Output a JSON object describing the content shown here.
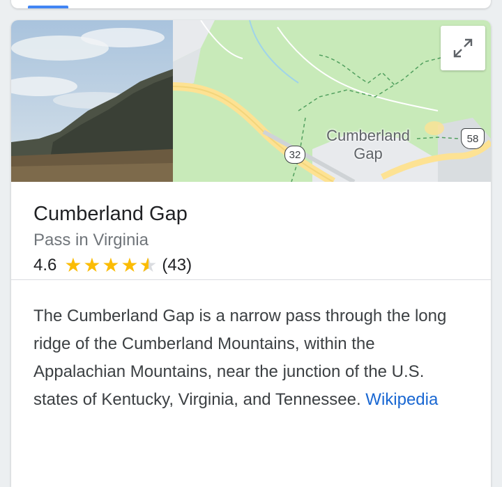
{
  "place": {
    "title": "Cumberland Gap",
    "subtitle": "Pass in Virginia",
    "rating": "4.6",
    "stars": 4.6,
    "review_count": "(43)"
  },
  "map": {
    "place_label_line1": "Cumberland",
    "place_label_line2": "Gap",
    "route_32": "32",
    "route_58": "58",
    "expand_icon": "expand-icon"
  },
  "description": {
    "text": "The Cumberland Gap is a narrow pass through the long ridge of the Cumberland Mountains, within the Appalachian Mountains, near the junction of the U.S. states of Kentucky, Virginia, and Tennessee. ",
    "source_link": "Wikipedia"
  },
  "colors": {
    "star": "#fbbc04",
    "link": "#1967d2",
    "map_green": "#c8eab9",
    "road_yellow": "#fde293"
  }
}
